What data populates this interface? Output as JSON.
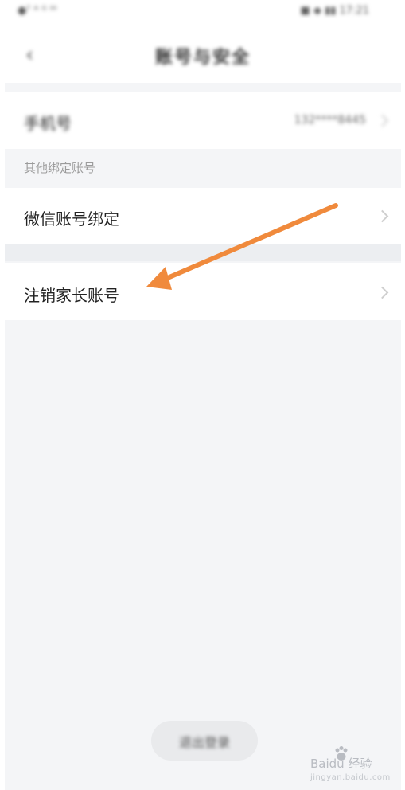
{
  "statusbar": {
    "left_text": "●ᵀ ᴬ ᴳ ᴵᴴ",
    "right_text": "■ ◆ ▮▮ 17:21"
  },
  "navbar": {
    "title": "账号与安全"
  },
  "rows": {
    "phone": {
      "label": "手机号",
      "value": "132****8445"
    },
    "section_header": "其他绑定账号",
    "wechat": {
      "label": "微信账号绑定"
    },
    "cancel": {
      "label": "注销家长账号"
    }
  },
  "bottom_button": {
    "label": "退出登录"
  },
  "watermark": {
    "brand": "Baidu 经验",
    "url": "jingyan.baidu.com"
  },
  "annotation": {
    "color": "#f08a3c"
  }
}
